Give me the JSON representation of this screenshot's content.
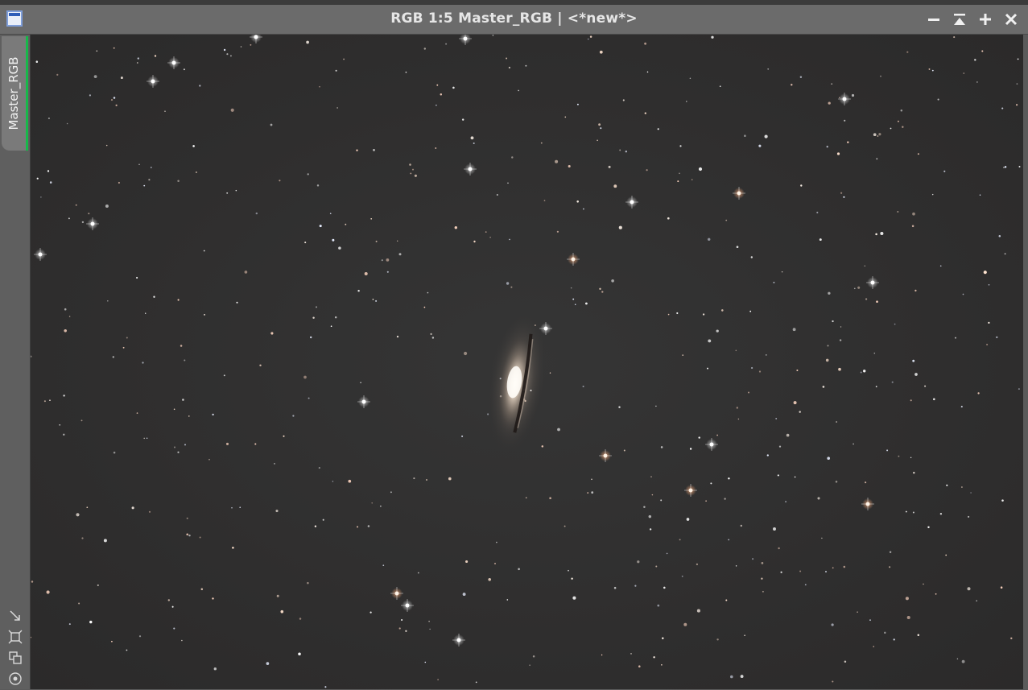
{
  "window": {
    "title": "RGB 1:5 Master_RGB | <*new*>",
    "icon": "image-window-icon",
    "controls": [
      "minimize-icon",
      "shade-icon",
      "maximize-icon",
      "close-icon"
    ]
  },
  "sidebar": {
    "tab_label": "Master_RGB",
    "tab_accent": "#17b84a",
    "tools": [
      "zoom-to-fit-icon",
      "fit-view-icon",
      "clone-view-icon",
      "target-icon"
    ]
  },
  "image": {
    "subject": "starfield-with-edge-on-galaxy",
    "background_color": "#2f2e2e"
  }
}
